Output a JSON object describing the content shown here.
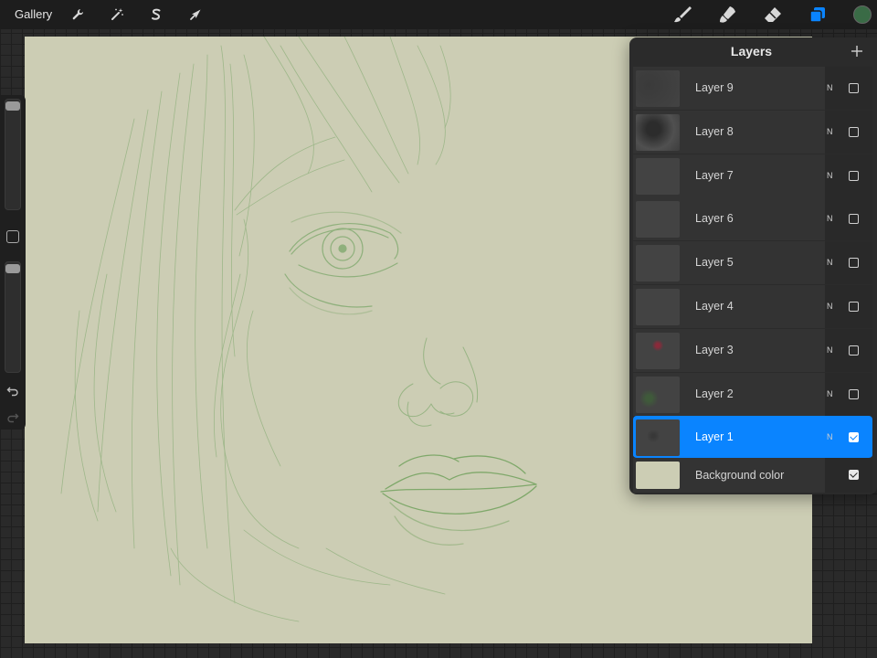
{
  "toolbar": {
    "gallery_label": "Gallery",
    "left_tools": [
      "wrench-icon",
      "magic-wand-icon",
      "selection-s-icon",
      "transform-arrow-icon"
    ],
    "right_tools": [
      "brush-icon",
      "smudge-icon",
      "eraser-icon",
      "layers-icon"
    ],
    "active_tool": "layers-icon",
    "active_color": "#3a6b46",
    "accent": "#0a84ff"
  },
  "canvas": {
    "background_color": "#cccdb4",
    "sketch_color": "#7fa86a"
  },
  "sidebar": {
    "brush_size_level": 0.0,
    "opacity_level": 0.0
  },
  "layers_panel": {
    "title": "Layers",
    "layers": [
      {
        "name": "Layer 9",
        "blend": "N",
        "visible": false,
        "active": false
      },
      {
        "name": "Layer 8",
        "blend": "N",
        "visible": false,
        "active": false
      },
      {
        "name": "Layer 7",
        "blend": "N",
        "visible": false,
        "active": false
      },
      {
        "name": "Layer 6",
        "blend": "N",
        "visible": false,
        "active": false
      },
      {
        "name": "Layer 5",
        "blend": "N",
        "visible": false,
        "active": false
      },
      {
        "name": "Layer 4",
        "blend": "N",
        "visible": false,
        "active": false
      },
      {
        "name": "Layer 3",
        "blend": "N",
        "visible": false,
        "active": false
      },
      {
        "name": "Layer 2",
        "blend": "N",
        "visible": false,
        "active": false
      },
      {
        "name": "Layer 1",
        "blend": "N",
        "visible": true,
        "active": true
      }
    ],
    "background": {
      "name": "Background color",
      "color": "#cccdb4",
      "visible": true
    }
  }
}
